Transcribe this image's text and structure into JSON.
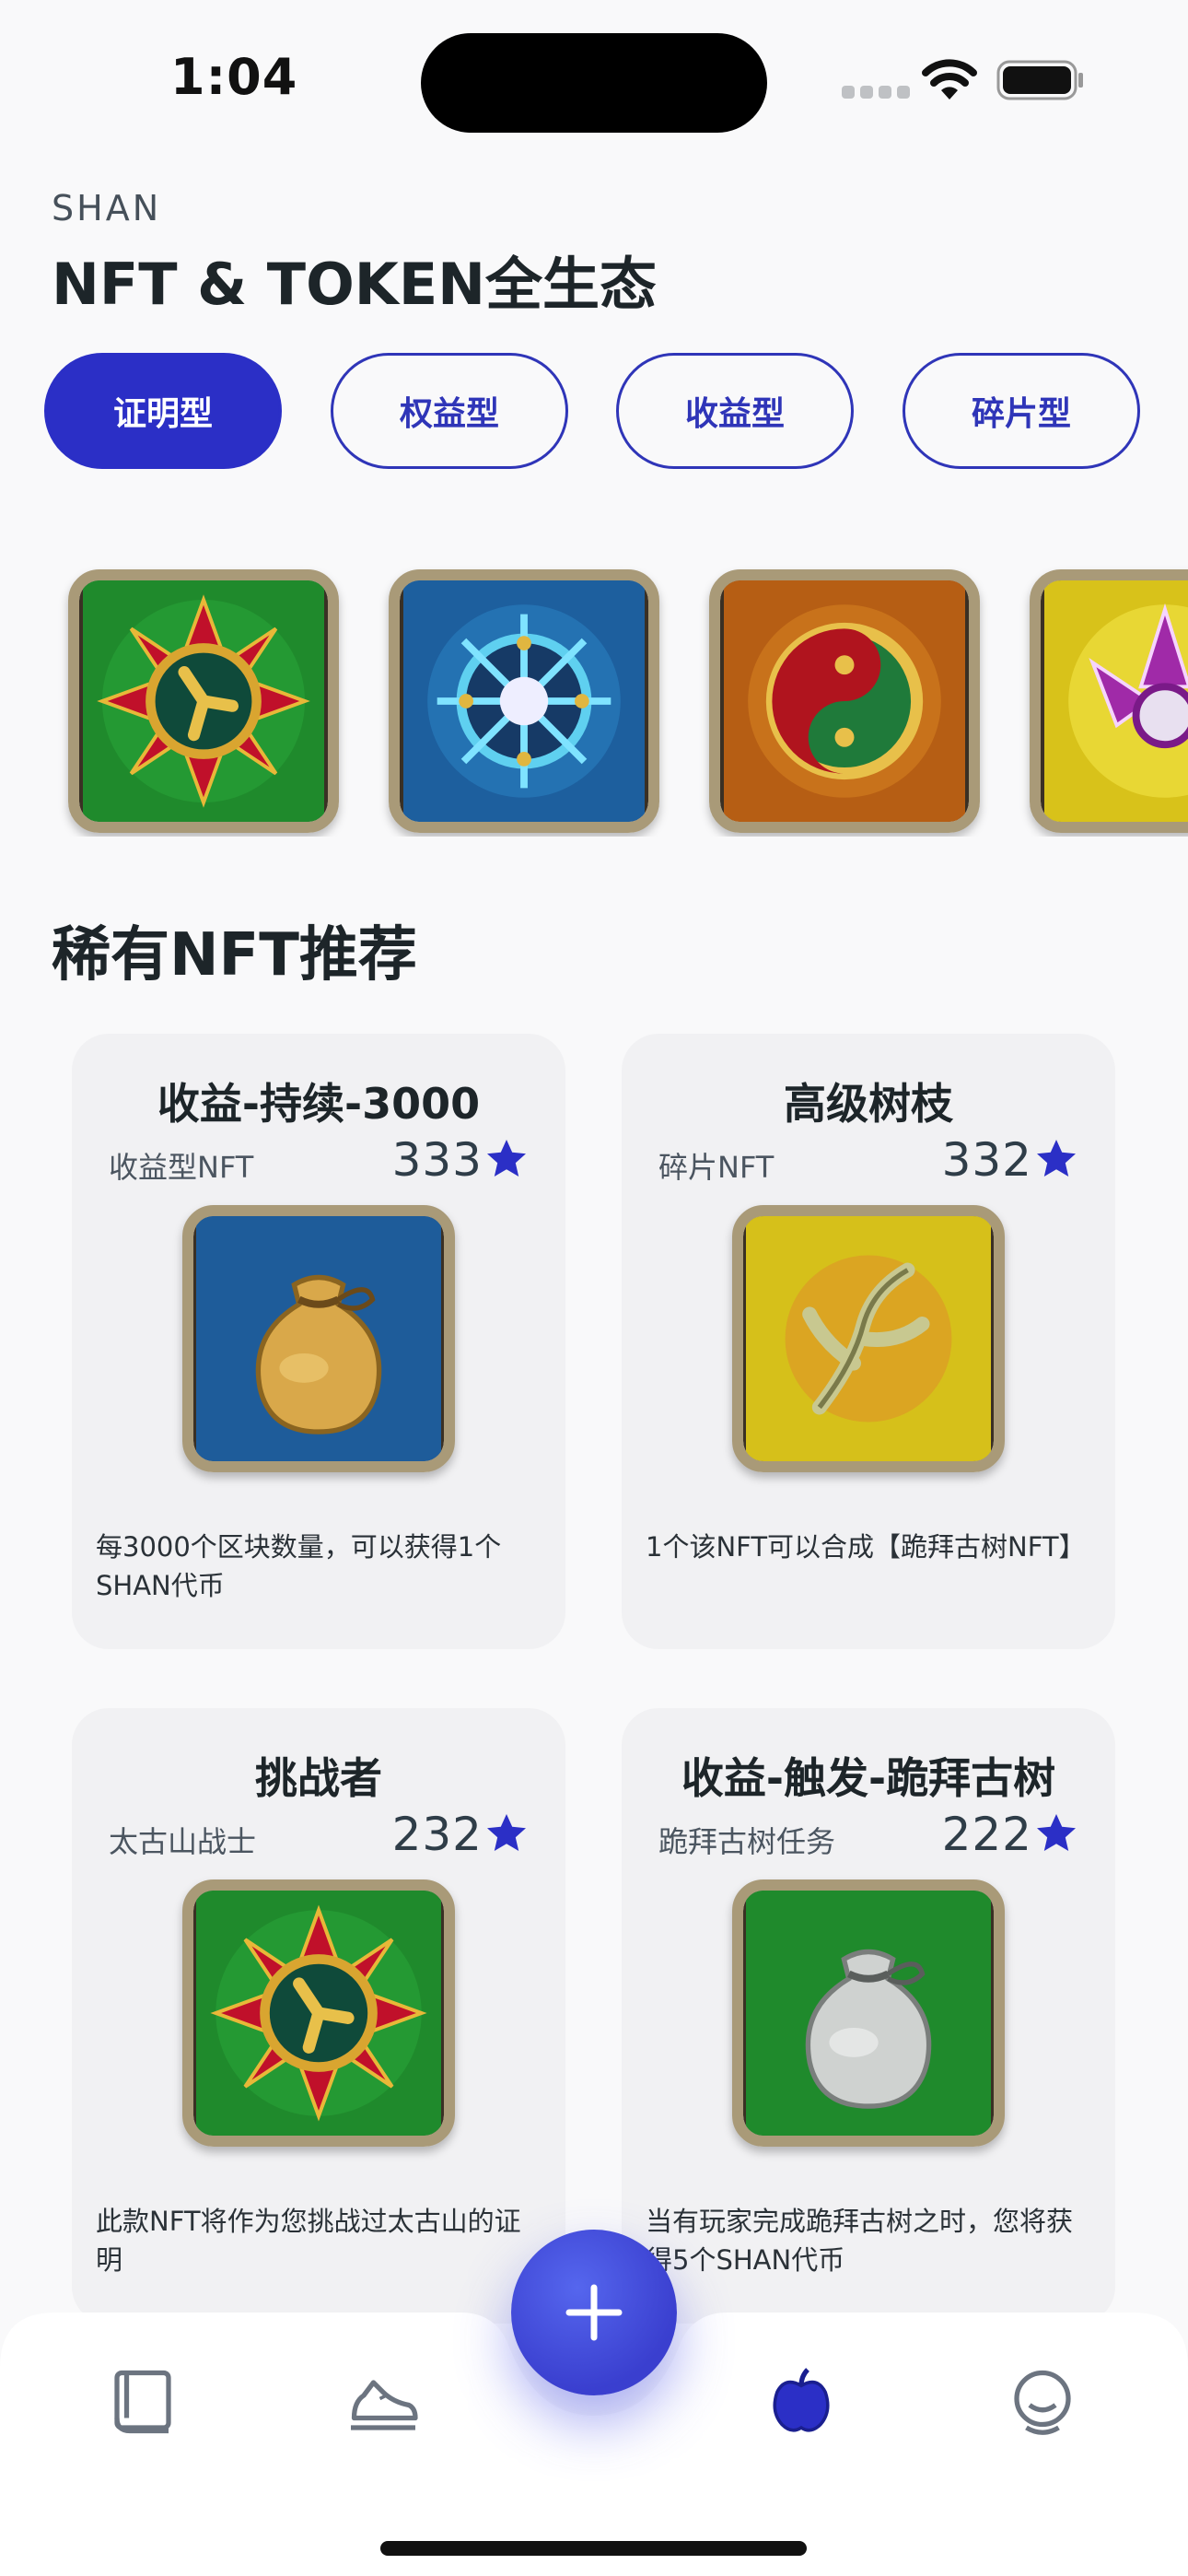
{
  "status_bar": {
    "time": "1:04"
  },
  "header": {
    "subtitle": "SHAN",
    "title": "NFT & TOKEN全生态"
  },
  "filters": [
    {
      "label": "证明型",
      "active": true
    },
    {
      "label": "权益型",
      "active": false
    },
    {
      "label": "收益型",
      "active": false
    },
    {
      "label": "碎片型",
      "active": false
    }
  ],
  "badges": [
    "flower-badge",
    "wheel-badge",
    "yinyang-badge",
    "lotus-badge"
  ],
  "section": {
    "title": "稀有NFT推荐"
  },
  "cards": [
    {
      "title": "收益-持续-3000",
      "type": "收益型NFT",
      "count": "333",
      "image": "gold-pouch",
      "desc": "每3000个区块数量，可以获得1个SHAN代币"
    },
    {
      "title": "高级树枝",
      "type": "碎片NFT",
      "count": "332",
      "image": "branch",
      "desc": "1个该NFT可以合成【跪拜古树NFT】"
    },
    {
      "title": "挑战者",
      "type": "太古山战士",
      "count": "232",
      "image": "flower-badge",
      "desc": "此款NFT将作为您挑战过太古山的证明"
    },
    {
      "title": "收益-触发-跪拜古树",
      "type": "跪拜古树任务",
      "count": "222",
      "image": "silver-pouch",
      "desc": "当有玩家完成跪拜古树之时，您将获得5个SHAN代币"
    }
  ],
  "tabs": [
    {
      "name": "book-icon"
    },
    {
      "name": "sneaker-icon"
    },
    {
      "name": "apple-icon",
      "active": true
    },
    {
      "name": "profile-icon"
    }
  ],
  "colors": {
    "accent": "#2b2fc6",
    "card_bg": "#f1f1f3",
    "frame": "#a99a78"
  }
}
